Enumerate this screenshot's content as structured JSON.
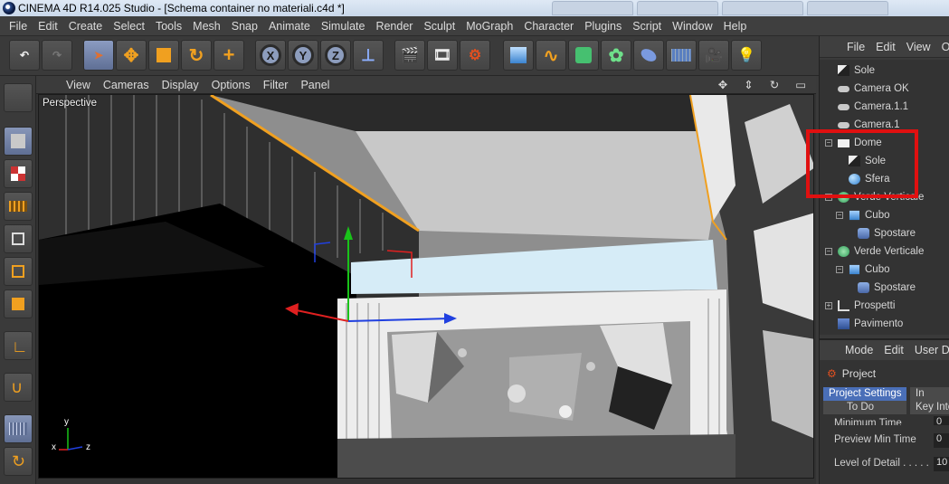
{
  "window": {
    "title": "CINEMA 4D R14.025 Studio - [Schema container no materiali.c4d *]"
  },
  "menubar": [
    "File",
    "Edit",
    "Create",
    "Select",
    "Tools",
    "Mesh",
    "Snap",
    "Animate",
    "Simulate",
    "Render",
    "Sculpt",
    "MoGraph",
    "Character",
    "Plugins",
    "Script",
    "Window",
    "Help"
  ],
  "toolbar": {
    "axes": [
      "X",
      "Y",
      "Z"
    ]
  },
  "viewport": {
    "menu": [
      "View",
      "Cameras",
      "Display",
      "Options",
      "Filter",
      "Panel"
    ],
    "label": "Perspective",
    "axis_labels": {
      "y": "y",
      "x": "x",
      "z": "z"
    }
  },
  "objects_panel": {
    "menu": [
      "File",
      "Edit",
      "View",
      "Ob"
    ],
    "items": [
      {
        "name": "Sole",
        "icon": "sun-icon"
      },
      {
        "name": "Camera OK",
        "icon": "camera-icon"
      },
      {
        "name": "Camera.1.1",
        "icon": "camera-icon"
      },
      {
        "name": "Camera.1",
        "icon": "camera-icon"
      },
      {
        "name": "Dome",
        "icon": "dome-icon"
      },
      {
        "name": "Sole",
        "icon": "sun-icon"
      },
      {
        "name": "Sfera",
        "icon": "sphere-icon"
      },
      {
        "name": "Verde Verticale",
        "icon": "green-object-icon"
      },
      {
        "name": "Cubo",
        "icon": "cube-icon"
      },
      {
        "name": "Spostare",
        "icon": "displacer-icon"
      },
      {
        "name": "Verde Verticale",
        "icon": "green-object-icon"
      },
      {
        "name": "Cubo",
        "icon": "cube-icon"
      },
      {
        "name": "Spostare",
        "icon": "displacer-icon"
      },
      {
        "name": "Prospetti",
        "icon": "null-icon"
      },
      {
        "name": "Pavimento",
        "icon": "floor-icon"
      }
    ]
  },
  "attributes_panel": {
    "menu": [
      "Mode",
      "Edit",
      "User Da"
    ],
    "title": "Project",
    "tabs": [
      "Project Settings",
      "In",
      "To Do",
      "Key Inte"
    ],
    "rows": [
      {
        "label": "Minimum Time",
        "value": "0"
      },
      {
        "label": "Preview Min Time",
        "value": "0"
      },
      {
        "label": "Level of Detail . . . . .",
        "value": "10"
      }
    ]
  },
  "colors": {
    "highlight_box": "#e01010",
    "accent_orange": "#f0a020",
    "selected_tab": "#4a6fb8"
  }
}
